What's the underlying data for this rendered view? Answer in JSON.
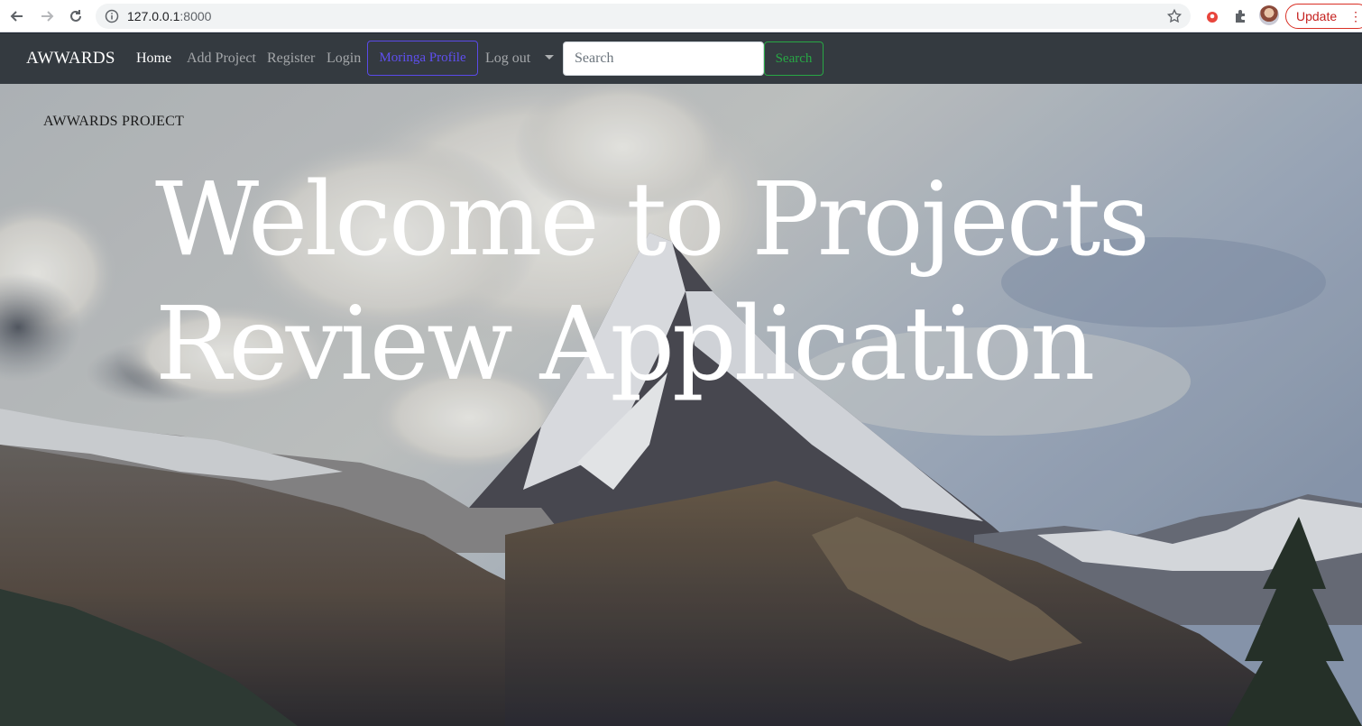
{
  "browser": {
    "url_host": "127.0.0.1",
    "url_port": ":8000",
    "update_label": "Update"
  },
  "navbar": {
    "brand": "AWWARDS",
    "links": [
      "Home",
      "Add Project",
      "Register",
      "Login"
    ],
    "profile_button": "Moringa Profile",
    "logout": "Log out",
    "search_placeholder": "Search",
    "search_button": "Search"
  },
  "hero": {
    "kicker": "AWWARDS PROJECT",
    "title_line1": "Welcome to Projects",
    "title_line2": "Review Application"
  },
  "colors": {
    "navbar_bg": "#343a40",
    "profile_accent": "#5f4ff0",
    "search_accent": "#28a745",
    "update_accent": "#d93025"
  }
}
